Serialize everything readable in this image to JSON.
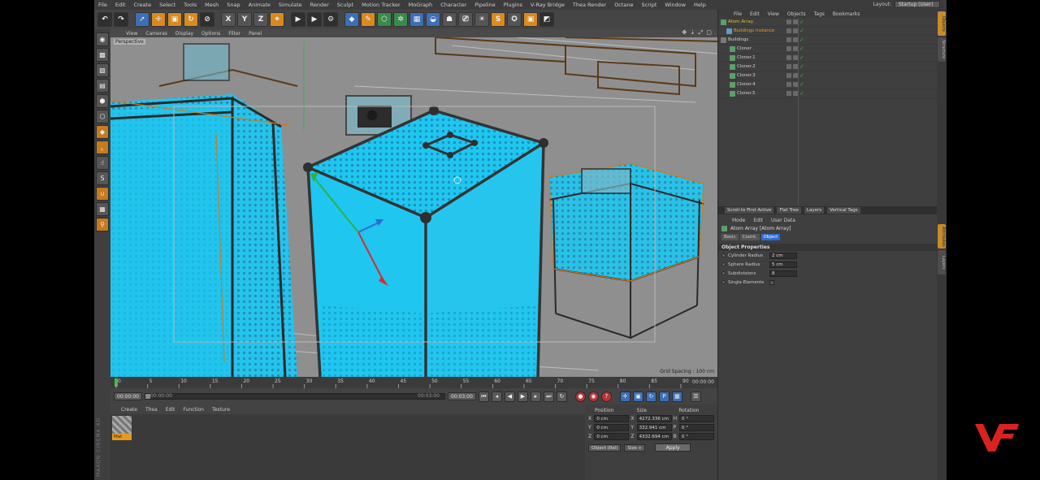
{
  "menubar": {
    "items": [
      "File",
      "Edit",
      "Create",
      "Select",
      "Tools",
      "Mesh",
      "Snap",
      "Animate",
      "Simulate",
      "Render",
      "Sculpt",
      "Motion Tracker",
      "MoGraph",
      "Character",
      "Pipeline",
      "Plugins",
      "V-Ray Bridge",
      "Thea Render",
      "Octane",
      "Script",
      "Window",
      "Help"
    ],
    "layout_label": "Layout:",
    "layout_value": "Startup (User)"
  },
  "toolbar": {
    "axis_x": "X",
    "axis_y": "Y",
    "axis_z": "Z"
  },
  "viewport": {
    "menu": [
      "View",
      "Cameras",
      "Display",
      "Options",
      "Filter",
      "Panel"
    ],
    "nav_icons": "✥ ⇣ ⤢ ▢",
    "camera_label": "Perspective",
    "grid_spacing": "Grid Spacing : 100 cm"
  },
  "timeline": {
    "ticks": [
      "0",
      "5",
      "10",
      "15",
      "20",
      "25",
      "30",
      "35",
      "40",
      "45",
      "50",
      "55",
      "60",
      "65",
      "70",
      "75",
      "80",
      "85",
      "90"
    ],
    "frame": "00:00:00"
  },
  "playbar": {
    "start_time": "00:00:00",
    "slider_start": "00:00:00",
    "slider_end": "00:03:00",
    "end_time": "00:03:00"
  },
  "materials": {
    "menu": [
      "Create",
      "Thea",
      "Edit",
      "Function",
      "Texture"
    ],
    "material_name": "Mat"
  },
  "coordinates": {
    "headers": [
      "Position",
      "Size",
      "Rotation"
    ],
    "rows": [
      {
        "axis": "X",
        "pos": "0 cm",
        "size": "4272.336 cm",
        "rot_axis": "H",
        "rot": "0 °"
      },
      {
        "axis": "Y",
        "pos": "0 cm",
        "size": "332.941 cm",
        "rot_axis": "P",
        "rot": "0 °"
      },
      {
        "axis": "Z",
        "pos": "0 cm",
        "size": "4332.694 cm",
        "rot_axis": "B",
        "rot": "0 °"
      }
    ],
    "mode": "Object (Rel)",
    "size_mode": "Size +",
    "apply": "Apply"
  },
  "object_manager": {
    "menu": [
      "File",
      "Edit",
      "View",
      "Objects",
      "Tags",
      "Bookmarks"
    ],
    "objects": [
      {
        "name": "Atom Array",
        "color": "#e0c030",
        "icon": "#5aa06a"
      },
      {
        "name": "Buildings Instance",
        "color": "#e0a030",
        "icon": "#5aa0c0"
      },
      {
        "name": "Buildings",
        "color": "#d0d0d0",
        "icon": "#7a7a7a"
      },
      {
        "name": "Cloner",
        "color": "#d0d0d0",
        "icon": "#5aa06a"
      },
      {
        "name": "Cloner.1",
        "color": "#d0d0d0",
        "icon": "#5aa06a"
      },
      {
        "name": "Cloner.2",
        "color": "#d0d0d0",
        "icon": "#5aa06a"
      },
      {
        "name": "Cloner.3",
        "color": "#d0d0d0",
        "icon": "#5aa06a"
      },
      {
        "name": "Cloner.4",
        "color": "#d0d0d0",
        "icon": "#5aa06a"
      },
      {
        "name": "Cloner.5",
        "color": "#d0d0d0",
        "icon": "#5aa06a"
      }
    ],
    "tabs": [
      "Scroll to First Active",
      "Flat Tree",
      "Layers",
      "Vertical Tags"
    ]
  },
  "attributes": {
    "menu": [
      "Mode",
      "Edit",
      "User Data"
    ],
    "title": "Atom Array [Atom Array]",
    "tabs": [
      "Basic",
      "Coord.",
      "Object"
    ],
    "section": "Object Properties",
    "props": [
      {
        "label": "Cylinder Radius",
        "value": "2 cm"
      },
      {
        "label": "Sphere Radius",
        "value": "5 cm"
      },
      {
        "label": "Subdivisions",
        "value": "8"
      }
    ],
    "checkbox_label": "Single Elements"
  },
  "right_strip_tabs": [
    "Objects",
    "Structure",
    "Attributes",
    "Layers"
  ],
  "brand": {
    "watermark_color": "#d8231f"
  },
  "colors": {
    "glass": "#1fc6f0",
    "wire_selected": "#d07a20"
  }
}
